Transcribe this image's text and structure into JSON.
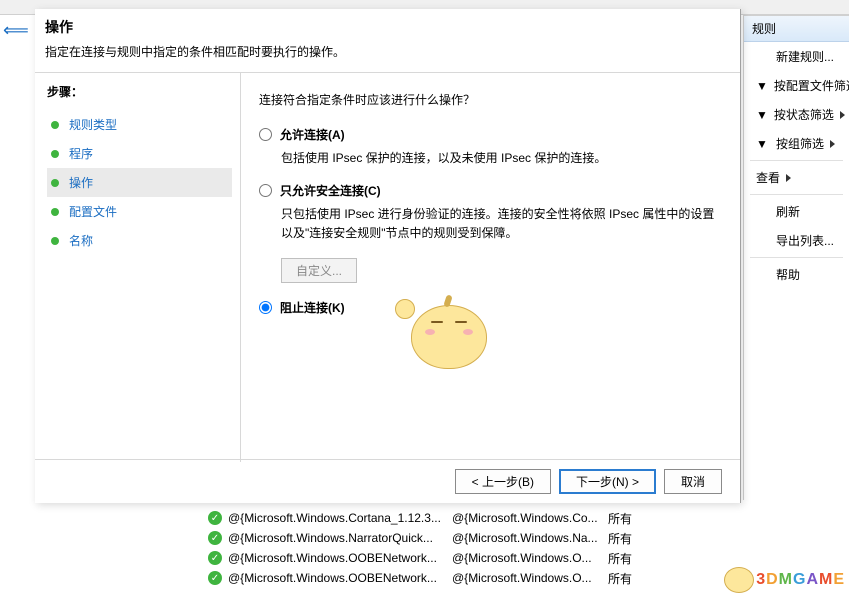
{
  "dialog": {
    "title": "操作",
    "subtitle": "指定在连接与规则中指定的条件相匹配时要执行的操作。",
    "steps_heading": "步骤：",
    "steps": [
      {
        "label": "规则类型"
      },
      {
        "label": "程序"
      },
      {
        "label": "操作"
      },
      {
        "label": "配置文件"
      },
      {
        "label": "名称"
      }
    ],
    "active_step_index": 2,
    "prompt": "连接符合指定条件时应该进行什么操作？",
    "options": [
      {
        "key": "allow",
        "label": "允许连接(A)",
        "desc": "包括使用 IPsec 保护的连接，以及未使用 IPsec 保护的连接。",
        "selected": false
      },
      {
        "key": "allow_secure",
        "label": "只允许安全连接(C)",
        "desc": "只包括使用 IPsec 进行身份验证的连接。连接的安全性将依照 IPsec 属性中的设置以及\"连接安全规则\"节点中的规则受到保障。",
        "selected": false,
        "custom_button": "自定义..."
      },
      {
        "key": "block",
        "label": "阻止连接(K)",
        "desc": "",
        "selected": true
      }
    ],
    "buttons": {
      "back": "< 上一步(B)",
      "next": "下一步(N) >",
      "cancel": "取消"
    }
  },
  "right_panel": {
    "header": "规则",
    "items": [
      {
        "label": "新建规则..."
      },
      {
        "label": "按配置文件筛选",
        "submenu": true
      },
      {
        "label": "按状态筛选",
        "submenu": true
      },
      {
        "label": "按组筛选",
        "submenu": true
      },
      {
        "label": "查看",
        "submenu": true
      },
      {
        "label": "刷新"
      },
      {
        "label": "导出列表..."
      },
      {
        "label": "帮助"
      }
    ]
  },
  "rules": [
    {
      "name": "@{Microsoft.Windows.Cortana_1.12.3...",
      "group": "@{Microsoft.Windows.Co...",
      "profile": "所有"
    },
    {
      "name": "@{Microsoft.Windows.NarratorQuick...",
      "group": "@{Microsoft.Windows.Na...",
      "profile": "所有"
    },
    {
      "name": "@{Microsoft.Windows.OOBENetwork...",
      "group": "@{Microsoft.Windows.O...",
      "profile": "所有"
    },
    {
      "name": "@{Microsoft.Windows.OOBENetwork...",
      "group": "@{Microsoft.Windows.O...",
      "profile": "所有"
    }
  ],
  "watermark": "3DMGAME"
}
